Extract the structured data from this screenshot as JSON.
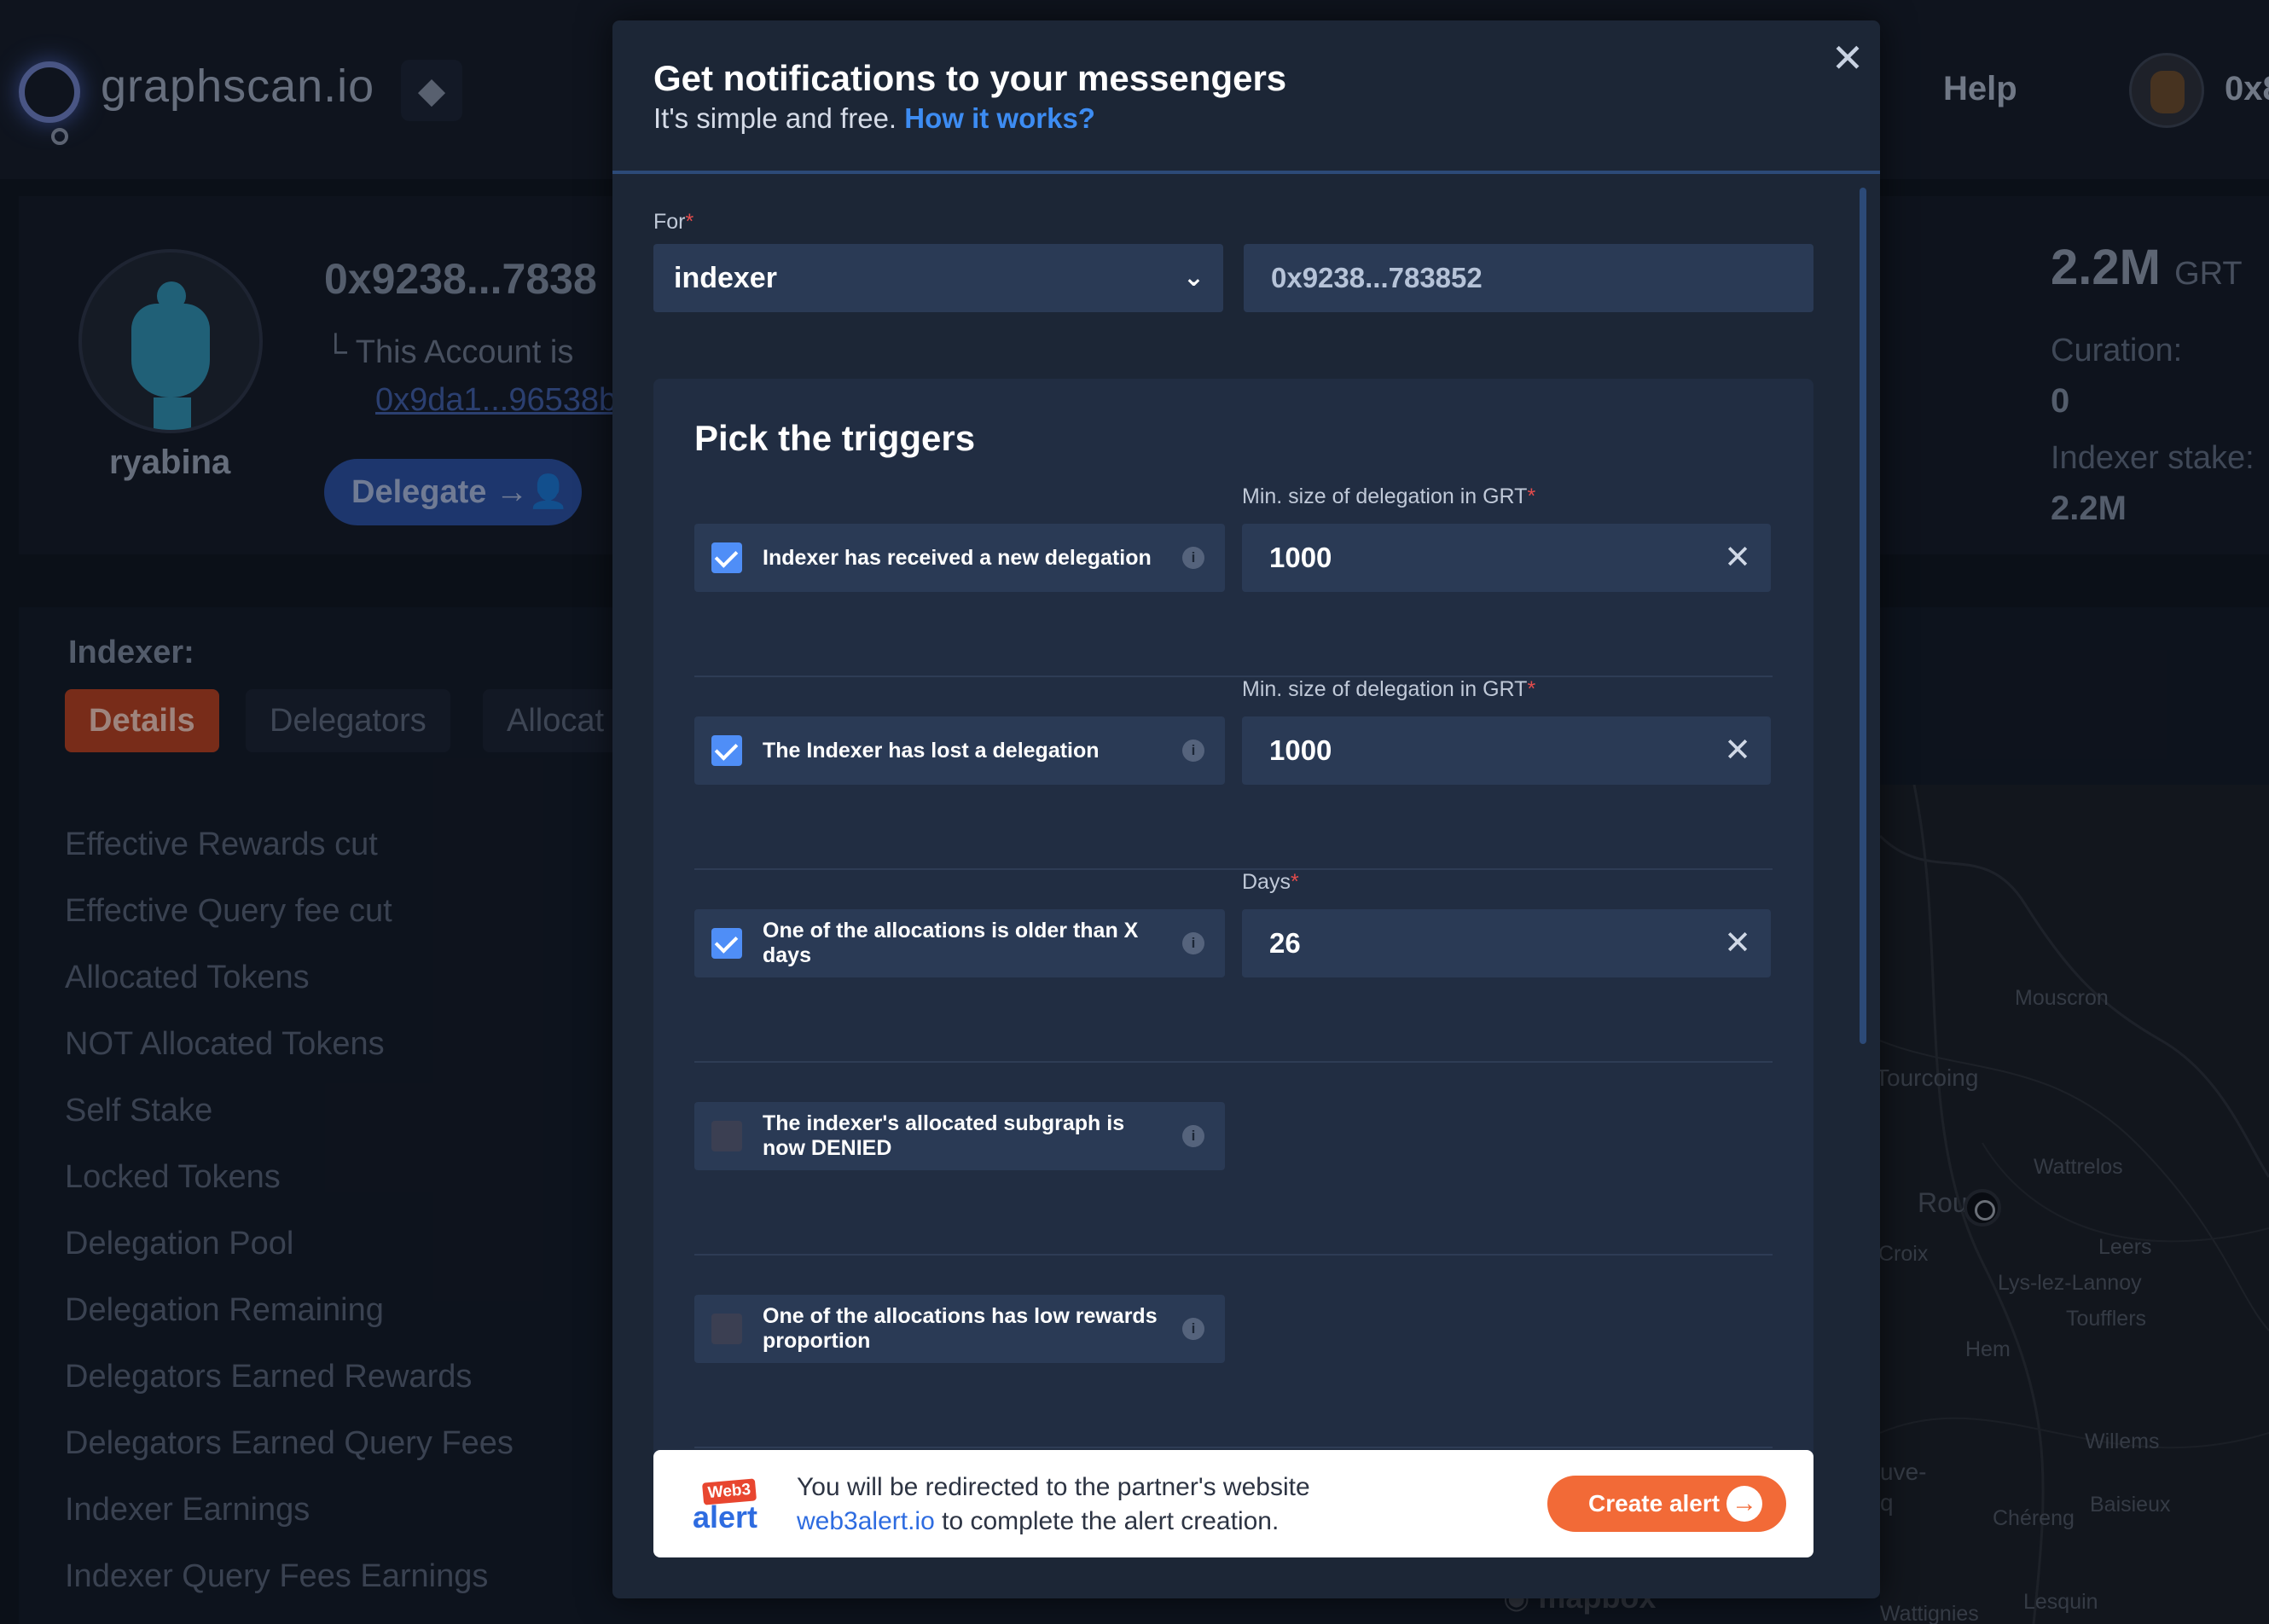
{
  "background": {
    "brand": "graphscan.io",
    "network_icon": "ethereum-icon",
    "nav": {
      "help": "Help",
      "user_address": "0x8"
    },
    "profile": {
      "name": "ryabina",
      "address": "0x9238...7838",
      "subtitle": "This Account is",
      "linked_address": "0x9da1...96538b",
      "delegate_label": "Delegate →👤"
    },
    "stats": {
      "total": "2.2M",
      "total_unit": "GRT",
      "curation_label": "Curation:",
      "curation_value": "0",
      "stake_label": "Indexer stake:",
      "stake_value": "2.2M"
    },
    "indexer_label": "Indexer:",
    "tabs": [
      "Details",
      "Delegators",
      "Allocat"
    ],
    "metrics": [
      "Effective Rewards cut",
      "Effective Query fee cut",
      "Allocated Tokens",
      "NOT Allocated Tokens",
      "Self Stake",
      "Locked Tokens",
      "Delegation Pool",
      "Delegation Remaining",
      "Delegators Earned Rewards",
      "Delegators Earned Query Fees",
      "Indexer Earnings",
      "Indexer Query Fees Earnings"
    ],
    "map": {
      "cities": [
        "Mouscron",
        "Tourcoing",
        "Wattrelos",
        "Rou",
        "Croix",
        "Leers",
        "Lys-lez-Lannoy",
        "Toufflers",
        "Hem",
        "Willems",
        "Baisieux",
        "Chéreng",
        "uve-",
        "q",
        "Wattignies",
        "Lesquin"
      ],
      "attribution": "mapbox"
    }
  },
  "modal": {
    "title": "Get notifications to your messengers",
    "subtitle": "It's simple and free.",
    "how_link": "How it works?",
    "close_icon": "close-icon",
    "for_label": "For",
    "required_mark": "*",
    "role_select": "indexer",
    "address": "0x9238...783852",
    "triggers_title": "Pick the triggers",
    "triggers": [
      {
        "label": "Indexer has received a new delegation",
        "checked": true,
        "field_label": "Min. size of delegation in GRT",
        "value": "1000"
      },
      {
        "label": "The Indexer has lost a delegation",
        "checked": true,
        "field_label": "Min. size of delegation in GRT",
        "value": "1000"
      },
      {
        "label": "One of the allocations is older than X days",
        "checked": true,
        "field_label": "Days",
        "value": "26"
      },
      {
        "label": "The indexer's allocated subgraph is now DENIED",
        "checked": false
      },
      {
        "label": "One of the allocations has low rewards proportion",
        "checked": false
      }
    ],
    "partner": {
      "badge": "Web3",
      "word": "alert",
      "text_1": "You will be redirected to the partner's website",
      "link": "web3alert.io",
      "text_2": "to complete the alert creation.",
      "button": "Create alert"
    }
  }
}
